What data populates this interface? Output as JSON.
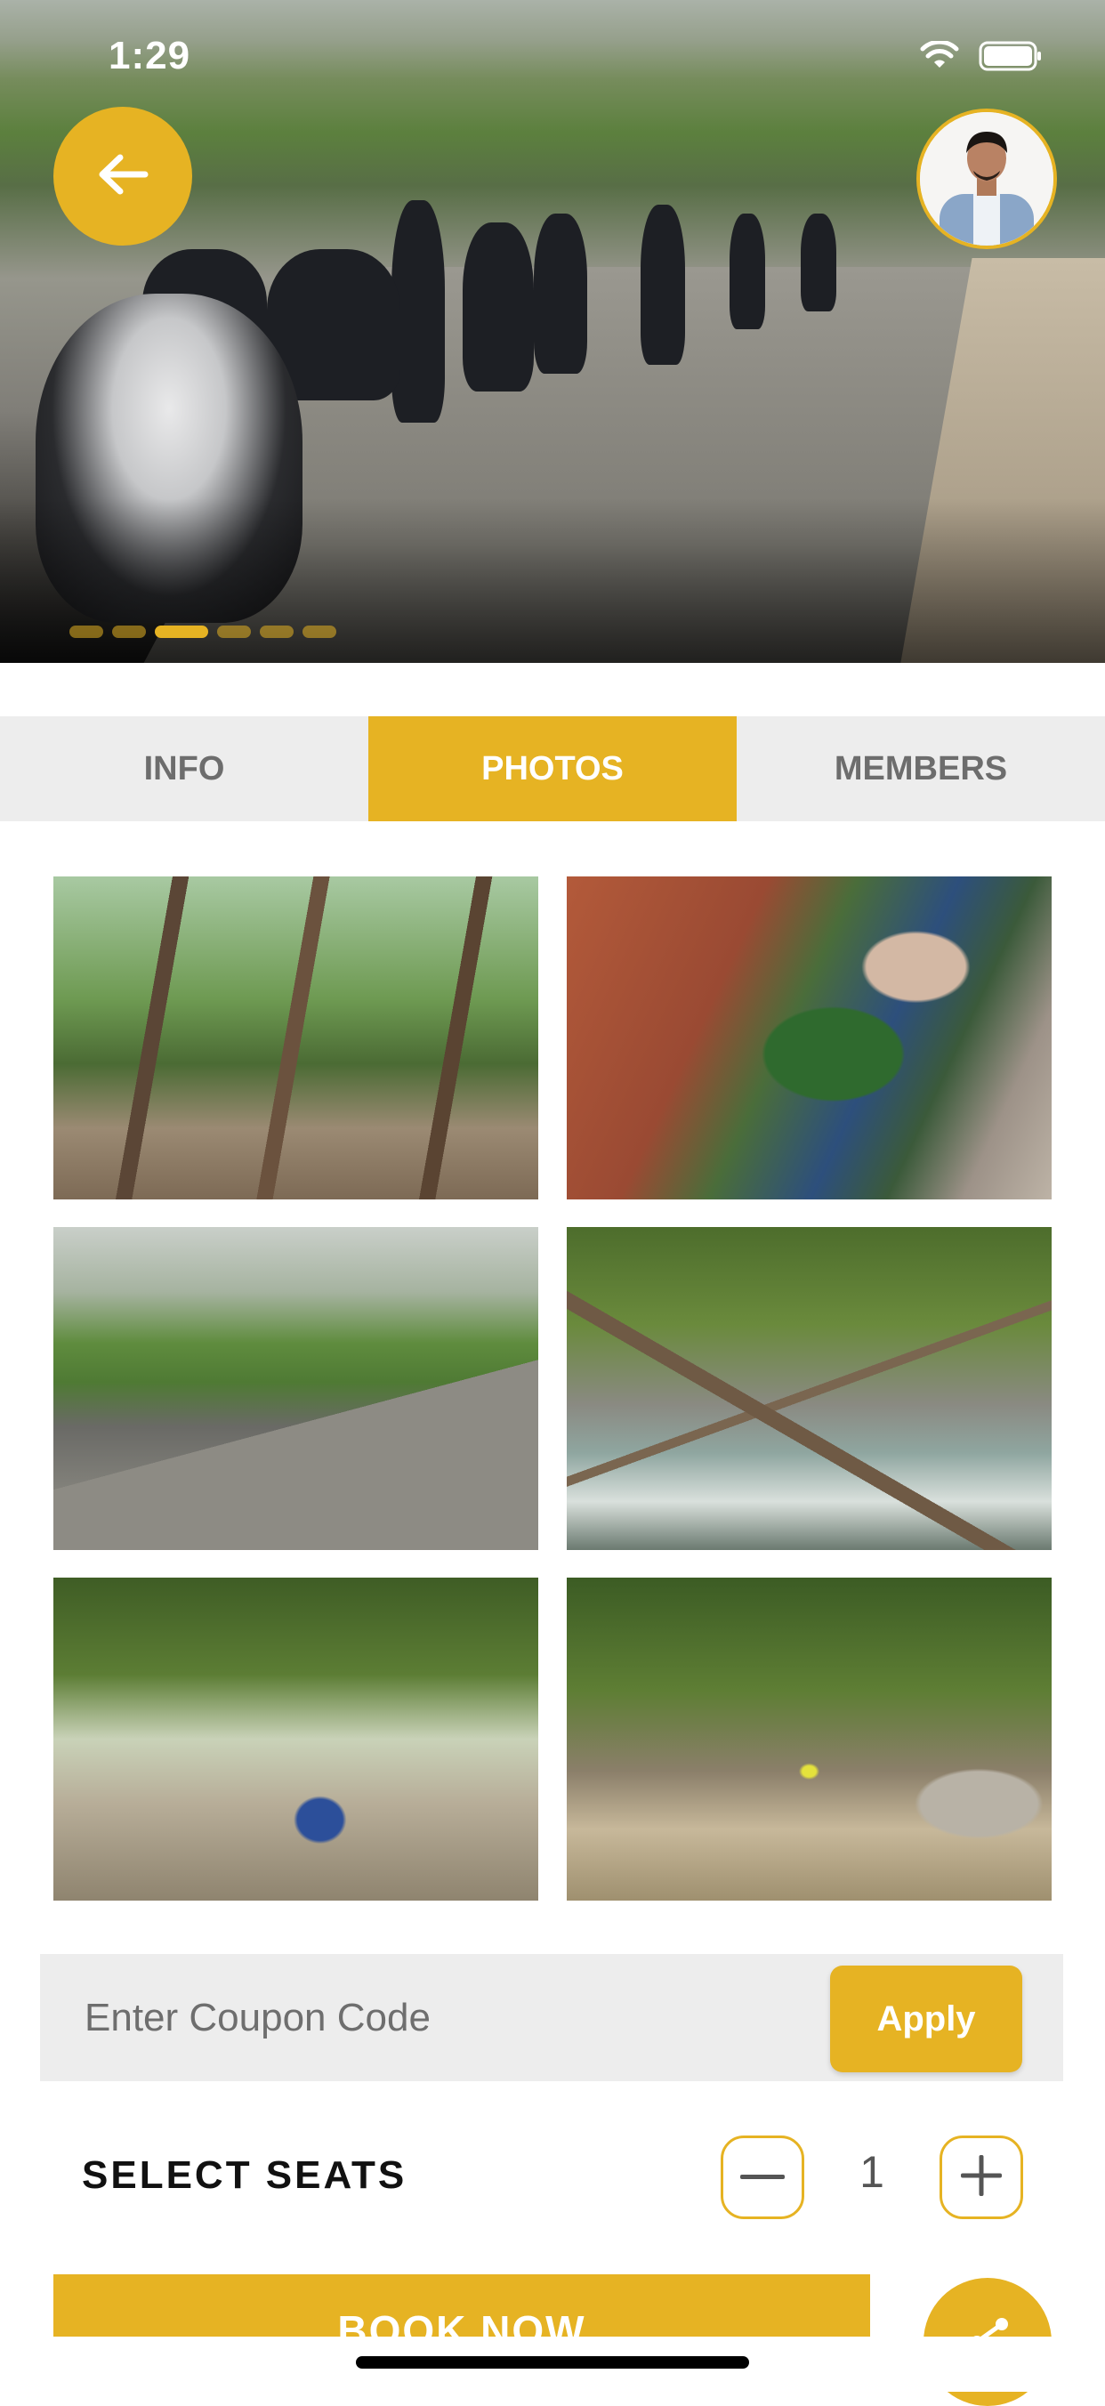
{
  "status_bar": {
    "time": "1:29",
    "icons": [
      "wifi-icon",
      "battery-icon"
    ]
  },
  "hero": {
    "carousel_count": 6,
    "active_index": 2,
    "icons": {
      "back": "arrow-left-icon"
    }
  },
  "tabs": [
    {
      "label": "INFO",
      "active": false
    },
    {
      "label": "PHOTOS",
      "active": true
    },
    {
      "label": "MEMBERS",
      "active": false
    }
  ],
  "photos": [
    "forest-riders",
    "monastery-riders",
    "road-riders",
    "river-bridge",
    "trail-riders",
    "creek-crossing"
  ],
  "coupon": {
    "placeholder": "Enter Coupon Code",
    "apply_label": "Apply"
  },
  "seats": {
    "label": "SELECT SEATS",
    "count": "1",
    "icons": {
      "minus": "minus-icon",
      "plus": "plus-icon"
    }
  },
  "book": {
    "label": "BOOK NOW"
  },
  "share": {
    "icon": "share-icon"
  },
  "colors": {
    "accent": "#e6b323",
    "tab_inactive_bg": "#ededed",
    "tab_inactive_text": "#6d6d6d"
  }
}
